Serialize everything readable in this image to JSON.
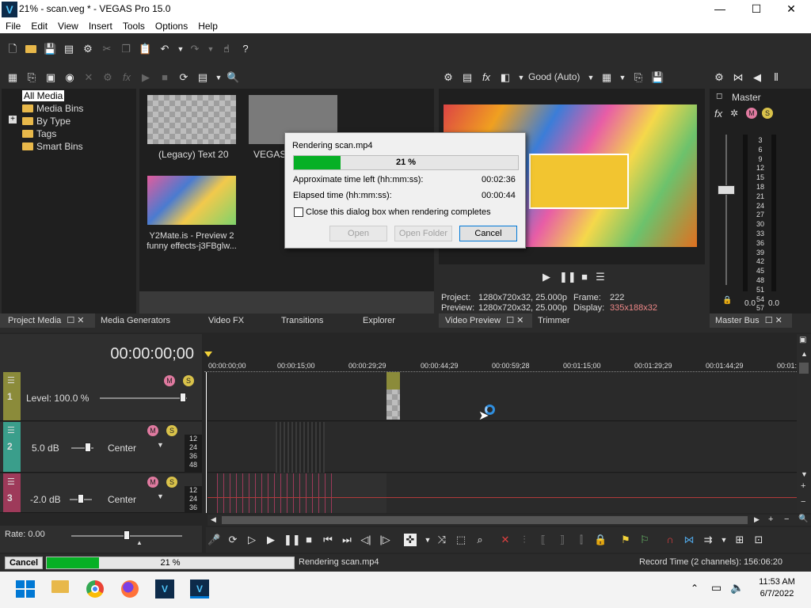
{
  "window": {
    "title": "21% - scan.veg * - VEGAS Pro 15.0",
    "logo": "V",
    "minimize": "—",
    "maximize": "☐",
    "close": "✕"
  },
  "menu": [
    "File",
    "Edit",
    "View",
    "Insert",
    "Tools",
    "Options",
    "Help"
  ],
  "explorer": {
    "items": [
      "All Media",
      "Media Bins",
      "By Type",
      "Tags",
      "Smart Bins"
    ],
    "expand": "+"
  },
  "media": {
    "thumbs": [
      {
        "label": "(Legacy) Text 20"
      },
      {
        "label": "VEGAS S"
      },
      {
        "label": "Y2Mate.is - Preview 2 funny effects-j3FBglw..."
      }
    ]
  },
  "dialog": {
    "title": "Rendering scan.mp4",
    "progress_pct": 21,
    "progress_text": "21 %",
    "time_left_label": "Approximate time left (hh:mm:ss):",
    "time_left": "00:02:36",
    "elapsed_label": "Elapsed time (hh:mm:ss):",
    "elapsed": "00:00:44",
    "checkbox_label": "Close this dialog box when rendering completes",
    "open": "Open",
    "open_folder": "Open Folder",
    "cancel": "Cancel"
  },
  "preview": {
    "quality": "Good (Auto)",
    "project_label": "Project:",
    "project_val": "1280x720x32, 25.000p",
    "frame_label": "Frame:",
    "frame_val": "222",
    "preview_label": "Preview:",
    "preview_val": "1280x720x32, 25.000p",
    "display_label": "Display:",
    "display_val": "335x188x32"
  },
  "master": {
    "label": "Master",
    "scale": [
      "3",
      "6",
      "9",
      "12",
      "15",
      "18",
      "21",
      "24",
      "27",
      "30",
      "33",
      "36",
      "39",
      "42",
      "45",
      "48",
      "51",
      "54",
      "57"
    ],
    "left_val": "0.0",
    "right_val": "0.0"
  },
  "tabs": {
    "left": [
      "Project Media",
      "Media Generators",
      "Video FX",
      "Transitions",
      "Explorer"
    ],
    "preview": [
      "Video Preview",
      "Trimmer"
    ],
    "master": [
      "Master Bus"
    ]
  },
  "timeline": {
    "timecode": "00:00:00;00",
    "ruler": [
      "00:00:00;00",
      "00:00:15;00",
      "00:00:29;29",
      "00:00:44;29",
      "00:00:59;28",
      "00:01:15;00",
      "00:01:29;29",
      "00:01:44;29",
      "00:01:"
    ],
    "tracks": [
      {
        "num": "1",
        "level": "Level: 100.0 %",
        "color": "#8b8b3a"
      },
      {
        "num": "2",
        "level": "5.0 dB",
        "pan": "Center",
        "color": "#3a9e8b"
      },
      {
        "num": "3",
        "level": "-2.0 dB",
        "pan": "Center",
        "color": "#9e3a5a"
      }
    ],
    "meter_scale": [
      "12",
      "24",
      "36",
      "48"
    ],
    "rate": "Rate: 0.00"
  },
  "status": {
    "cancel": "Cancel",
    "progress_pct": 21,
    "progress_text": "21 %",
    "rendering": "Rendering scan.mp4",
    "record_time": "Record Time (2 channels): 156:06:20"
  },
  "taskbar": {
    "time": "11:53 AM",
    "date": "6/7/2022"
  }
}
